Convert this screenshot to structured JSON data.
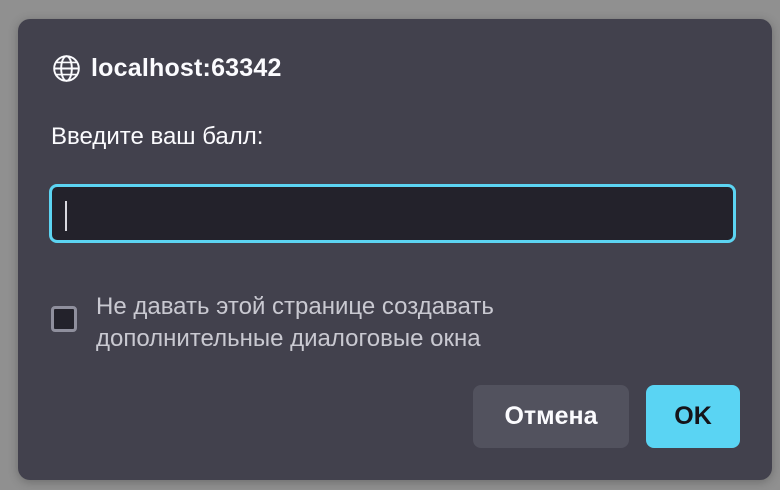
{
  "dialog": {
    "origin": "localhost:63342",
    "message": "Введите ваш балл:",
    "input_value": "",
    "checkbox_label": "Не давать этой странице создавать дополнительные диалоговые окна",
    "checkbox_checked": false,
    "cancel_label": "Отмена",
    "ok_label": "OK"
  },
  "icons": {
    "origin_icon": "globe-icon"
  },
  "colors": {
    "dialog_bg": "#42414d",
    "input_bg": "#23222b",
    "focus_accent": "#5cd4f2",
    "primary_button": "#5ad4f3",
    "secondary_button": "#52525e"
  }
}
